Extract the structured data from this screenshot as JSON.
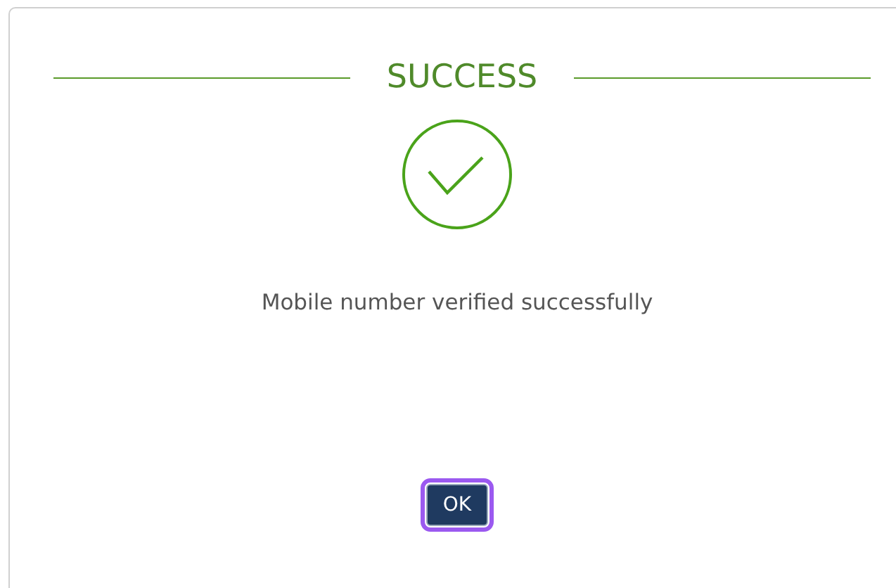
{
  "dialog": {
    "title": "SUCCESS",
    "kind": "success",
    "message": "Mobile number verified successfully",
    "button": {
      "label": "OK",
      "focused": true
    }
  }
}
